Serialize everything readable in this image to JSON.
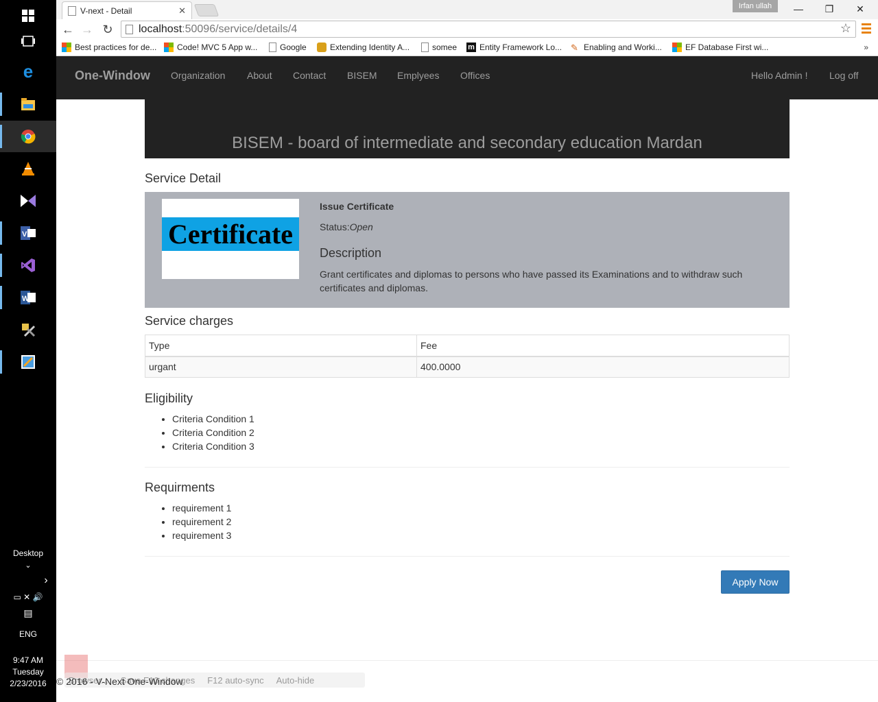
{
  "taskbar": {
    "desktop_label": "Desktop",
    "lang": "ENG",
    "time": "9:47 AM",
    "day": "Tuesday",
    "date": "2/23/2016"
  },
  "browser": {
    "tab_title": "V-next - Detail",
    "user": "Irfan ullah",
    "url_host": "localhost",
    "url_path": ":50096/service/details/4",
    "bookmarks": [
      {
        "label": "Best practices for de...",
        "icon": "ms"
      },
      {
        "label": "Code! MVC 5 App w...",
        "icon": "ms"
      },
      {
        "label": "Google",
        "icon": "doc"
      },
      {
        "label": "Extending Identity A...",
        "icon": "ident"
      },
      {
        "label": "somee",
        "icon": "doc"
      },
      {
        "label": "Entity Framework Lo...",
        "icon": "m"
      },
      {
        "label": "Enabling and Worki...",
        "icon": "feather"
      },
      {
        "label": "EF Database First wi...",
        "icon": "ms"
      }
    ],
    "bookmarks_more": "»"
  },
  "nav": {
    "brand": "One-Window",
    "links": [
      "Organization",
      "About",
      "Contact",
      "BISEM",
      "Emplyees",
      "Offices"
    ],
    "greeting": "Hello Admin !",
    "logoff": "Log off"
  },
  "banner_title": "BISEM - board of intermediate and secondary education Mardan",
  "service": {
    "section_title": "Service Detail",
    "image_text": "Certificate",
    "name": "Issue Certificate",
    "status_label": "Status:",
    "status_value": "Open",
    "description_title": "Description",
    "description": "Grant certificates and diplomas to persons who have passed its Examinations and to withdraw such certificates and diplomas."
  },
  "charges": {
    "title": "Service charges",
    "headers": [
      "Type",
      "Fee"
    ],
    "rows": [
      [
        "urgant",
        "400.0000"
      ]
    ]
  },
  "eligibility": {
    "title": "Eligibility",
    "items": [
      "Criteria Condition 1",
      "Criteria Condition 2",
      "Criteria Condition 3"
    ]
  },
  "requirements": {
    "title": "Requirments",
    "items": [
      "requirement 1",
      "requirement 2",
      "requirement 3"
    ]
  },
  "apply_label": "Apply Now",
  "footer": "© 2016 - V-Next One-Window",
  "browserlink": {
    "items": [
      "Browser...",
      "Save F10 changes",
      "F12 auto-sync",
      "Auto-hide"
    ]
  },
  "colors": {
    "navbar": "#222222",
    "detail_bg": "#aeb1b8",
    "primary": "#337ab7",
    "certificate_band": "#0fa2e4"
  }
}
